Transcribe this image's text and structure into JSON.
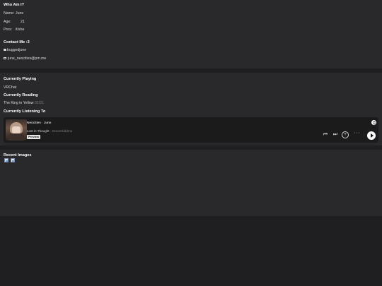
{
  "whoami": {
    "heading": "Who Am I?",
    "name_label": "Name:",
    "name_value": "June",
    "age_label": "Age:",
    "age_value": "21",
    "prns_label": "Prns:",
    "prns_value": "it/she"
  },
  "contact": {
    "heading": "Contact Me :3",
    "discord": "buggedjune",
    "email": "june_neocities@pm.me",
    "discord_icon": "chat-bubble-icon",
    "email_icon": "envelope-icon"
  },
  "status": {
    "playing_heading": "Currently Playing",
    "playing_value": "VRChat",
    "reading_heading": "Currently Reading",
    "reading_title": "The King in Yellow",
    "reading_progress": "02/21",
    "listening_heading": "Currently Listening To"
  },
  "spotify": {
    "playlist_title": "Neocities · June",
    "track": "Lost in Thought",
    "artist": "Dreamkiddmo",
    "preview_label": "Preview",
    "icons": [
      "spotify-logo-icon",
      "skip-back-icon",
      "skip-forward-icon",
      "add-icon",
      "more-icon",
      "play-icon"
    ]
  },
  "recent": {
    "heading": "Recent Images"
  }
}
